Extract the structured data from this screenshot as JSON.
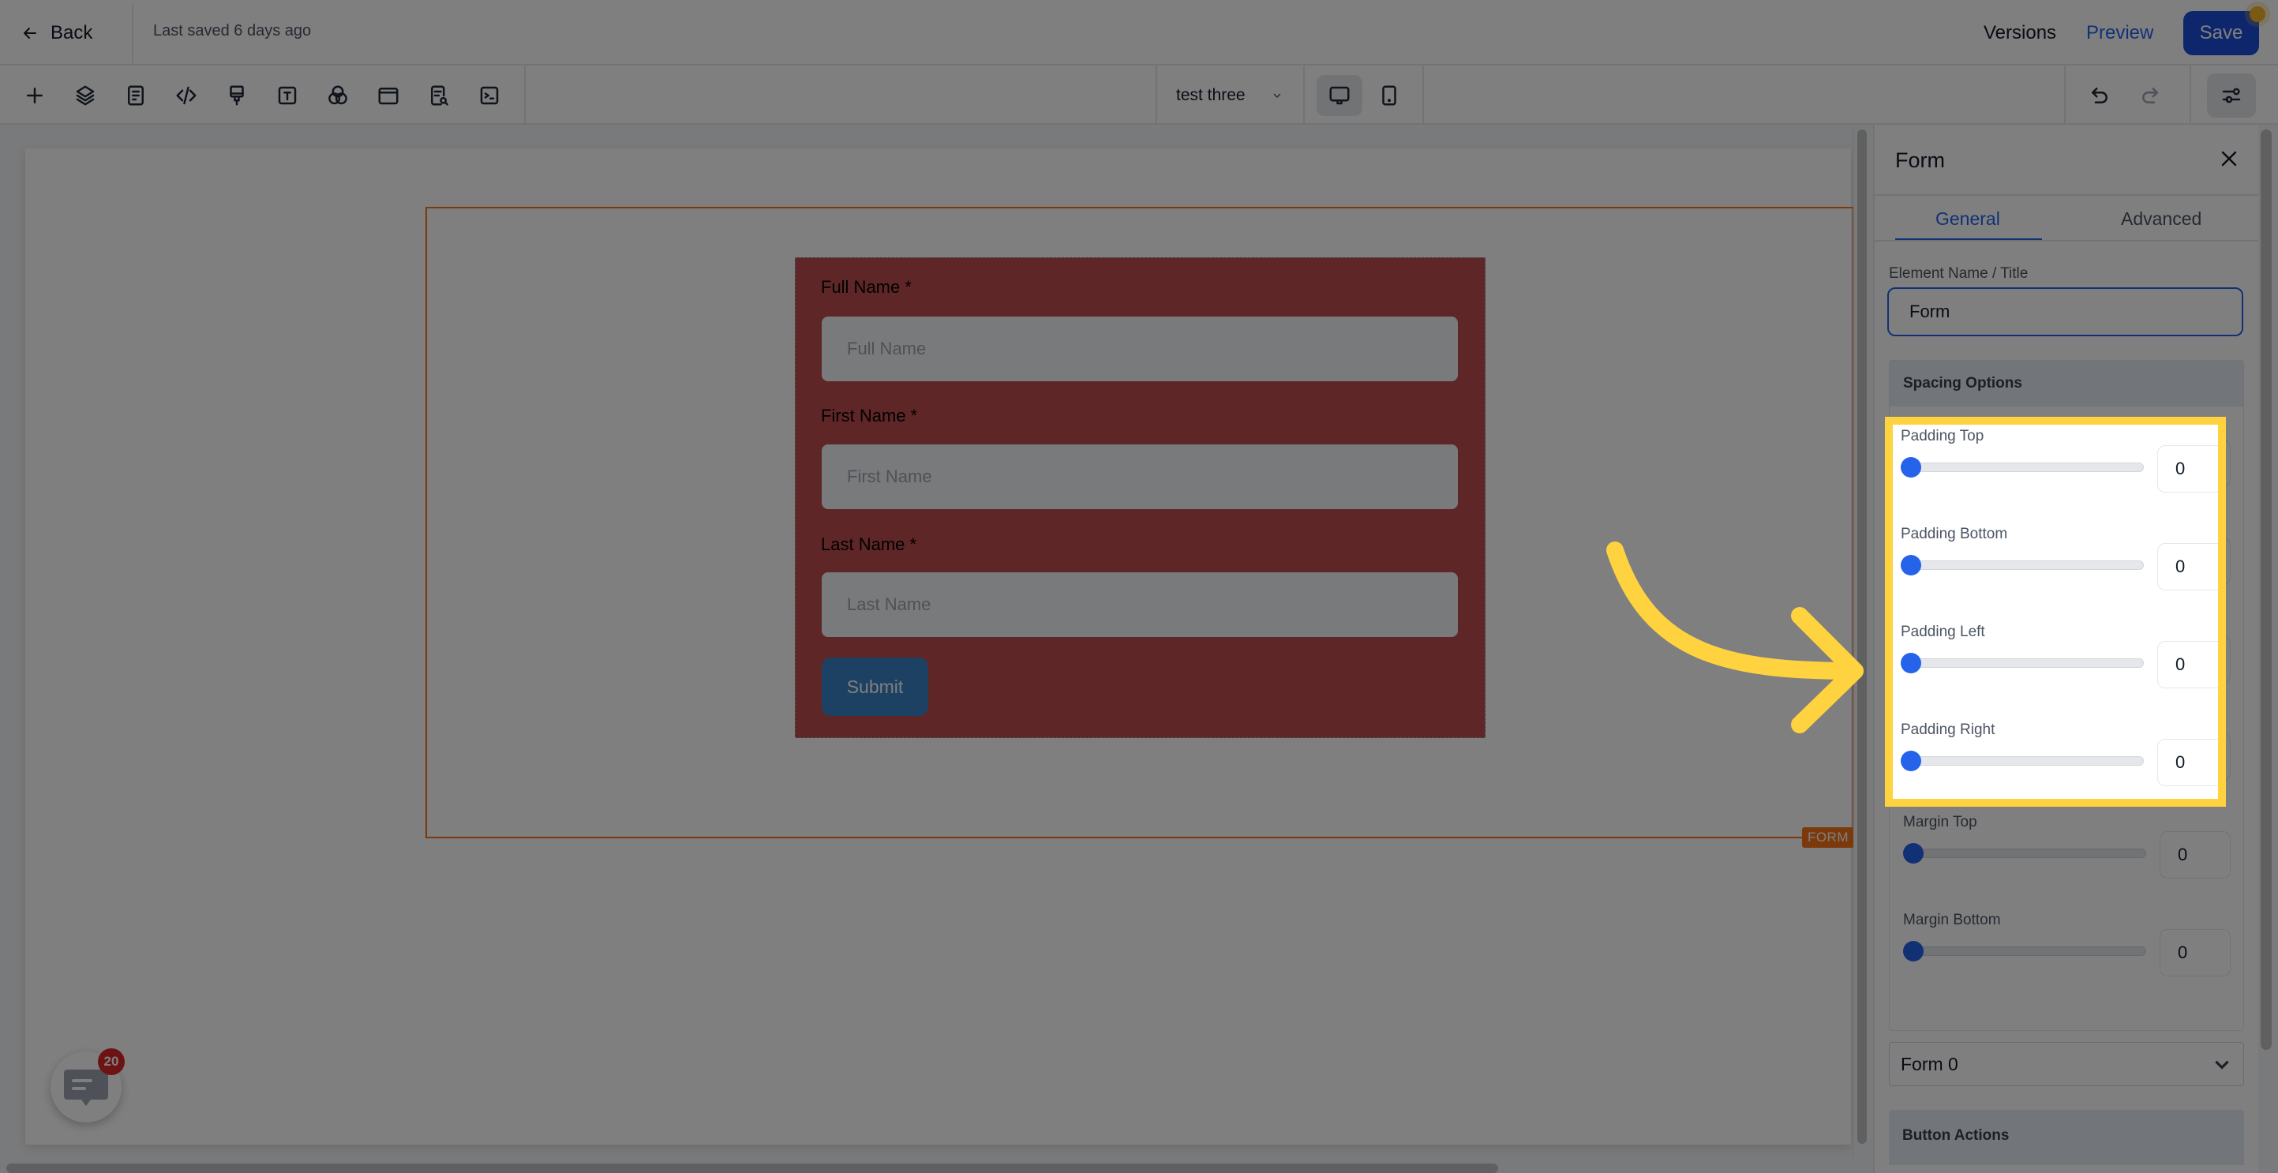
{
  "header": {
    "back_label": "Back",
    "last_saved": "Last saved 6 days ago",
    "versions_label": "Versions",
    "preview_label": "Preview",
    "save_label": "Save"
  },
  "toolbar": {
    "tools": [
      {
        "icon": "plus-icon",
        "label": "Add element"
      },
      {
        "icon": "layers-icon",
        "label": "Layers"
      },
      {
        "icon": "document-icon",
        "label": "Pages"
      },
      {
        "icon": "code-icon",
        "label": "Custom code"
      },
      {
        "icon": "paint-brush-icon",
        "label": "Styles"
      },
      {
        "icon": "text-icon",
        "label": "Typography"
      },
      {
        "icon": "color-circles-icon",
        "label": "Colors"
      },
      {
        "icon": "layout-icon",
        "label": "Layout"
      },
      {
        "icon": "document-search-icon",
        "label": "SEO"
      },
      {
        "icon": "terminal-icon",
        "label": "Scripts"
      }
    ],
    "page_select": "test three",
    "devices": [
      {
        "icon": "desktop-icon",
        "active": true
      },
      {
        "icon": "mobile-icon",
        "active": false
      }
    ],
    "undo_enabled": true,
    "redo_enabled": false
  },
  "canvas": {
    "selected_tag": "FORM",
    "form": {
      "fields": [
        {
          "label": "Full Name *",
          "placeholder": "Full Name"
        },
        {
          "label": "First Name *",
          "placeholder": "First Name"
        },
        {
          "label": "Last Name *",
          "placeholder": "Last Name"
        }
      ],
      "submit_label": "Submit"
    },
    "chat_badge_count": "20"
  },
  "panel": {
    "title": "Form",
    "tabs": [
      {
        "label": "General",
        "active": true
      },
      {
        "label": "Advanced",
        "active": false
      }
    ],
    "element_name_label": "Element Name / Title",
    "element_name_value": "Form",
    "spacing_section": "Spacing Options",
    "spacing": [
      {
        "label": "Padding Top",
        "value": "0",
        "fraction": 0
      },
      {
        "label": "Padding Bottom",
        "value": "0",
        "fraction": 0
      },
      {
        "label": "Padding Left",
        "value": "0",
        "fraction": 0
      },
      {
        "label": "Padding Right",
        "value": "0",
        "fraction": 0
      },
      {
        "label": "Margin Top",
        "value": "0",
        "fraction": 0
      },
      {
        "label": "Margin Bottom",
        "value": "0",
        "fraction": 0
      }
    ],
    "form_select_value": "Form 0",
    "button_actions_section": "Button Actions"
  },
  "colors": {
    "accent": "#2563eb",
    "save_button": "#1d4ed8",
    "form_background": "#bc4c4c",
    "submit_button": "#3b82c4",
    "selection_outline": "#f97316",
    "annotation_highlight": "#ffd23f",
    "badge": "#dc2626"
  }
}
